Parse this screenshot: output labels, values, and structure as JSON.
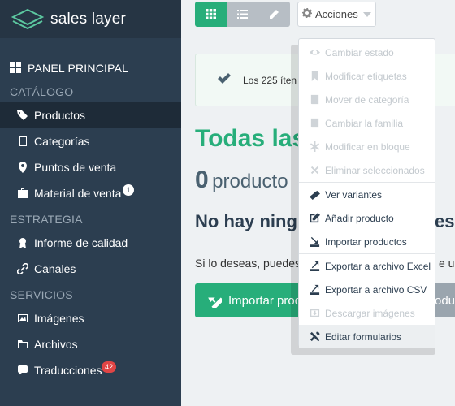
{
  "brand": {
    "name": "sales layer"
  },
  "sidebar": {
    "main": "PANEL PRINCIPAL",
    "sections": [
      {
        "title": "CATÁLOGO",
        "items": [
          {
            "label": "Productos",
            "icon": "tags-icon",
            "active": true
          },
          {
            "label": "Categorías",
            "icon": "book-icon"
          },
          {
            "label": "Puntos de venta",
            "icon": "map-marker-icon"
          },
          {
            "label": "Material de venta",
            "icon": "briefcase-icon",
            "badge": "1"
          }
        ]
      },
      {
        "title": "ESTRATEGIA",
        "items": [
          {
            "label": "Informe de calidad",
            "icon": "ribbon-icon"
          },
          {
            "label": "Canales",
            "icon": "link-icon"
          }
        ]
      },
      {
        "title": "SERVICIOS",
        "items": [
          {
            "label": "Imágenes",
            "icon": "image-icon"
          },
          {
            "label": "Archivos",
            "icon": "folder-icon"
          },
          {
            "label": "Traducciones",
            "icon": "chat-icon",
            "badge": "42"
          }
        ]
      }
    ]
  },
  "toolbar": {
    "acciones_label": "Acciones"
  },
  "notice": {
    "text": "Los 225 íten"
  },
  "content": {
    "title": "Todas las",
    "count_num": "0",
    "count_label": "producto",
    "empty_title": "No hay ning",
    "empty_suffix": "es",
    "hint": "Si lo deseas, puedes",
    "hint_suffix": "e u",
    "import_label": "Importar prod",
    "grey_label": "oduc"
  },
  "dropdown": {
    "items": [
      {
        "label": "Cambiar estado",
        "icon": "eye-icon",
        "disabled": true
      },
      {
        "label": "Modificar etiquetas",
        "icon": "bookmark-icon",
        "disabled": true
      },
      {
        "label": "Mover de categoría",
        "icon": "book-icon",
        "disabled": true
      },
      {
        "label": "Cambiar la familia",
        "icon": "book-icon",
        "disabled": true
      },
      {
        "label": "Modificar en bloque",
        "icon": "asterisk-icon",
        "disabled": true
      },
      {
        "label": "Eliminar seleccionados",
        "icon": "close-icon",
        "disabled": true
      },
      {
        "label": "Ver variantes",
        "icon": "variants-icon",
        "disabled": false
      },
      {
        "label": "Añadir producto",
        "icon": "edit-icon",
        "disabled": false
      },
      {
        "label": "Importar productos",
        "icon": "import-icon",
        "disabled": false
      },
      {
        "label": "Exportar a archivo Excel",
        "icon": "export-icon",
        "disabled": false
      },
      {
        "label": "Exportar a archivo CSV",
        "icon": "export-icon",
        "disabled": false
      },
      {
        "label": "Descargar imágenes",
        "icon": "download-icon",
        "disabled": true
      },
      {
        "label": "Editar formularios",
        "icon": "tools-icon",
        "disabled": false,
        "hover": true
      }
    ]
  }
}
